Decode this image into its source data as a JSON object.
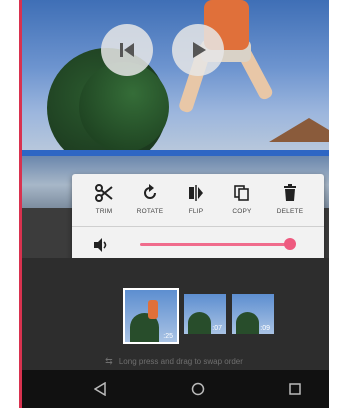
{
  "edit_panel": {
    "tools": [
      {
        "label": "TRIM",
        "icon": "scissors-icon"
      },
      {
        "label": "ROTATE",
        "icon": "rotate-icon"
      },
      {
        "label": "FLIP",
        "icon": "flip-icon"
      },
      {
        "label": "COPY",
        "icon": "copy-icon"
      },
      {
        "label": "DELETE",
        "icon": "trash-icon"
      }
    ],
    "volume": {
      "icon": "volume-icon",
      "level": 0.97
    }
  },
  "player": {
    "controls": [
      {
        "name": "previous",
        "icon": "skip-previous-icon"
      },
      {
        "name": "play",
        "icon": "play-icon"
      }
    ]
  },
  "clips": [
    {
      "duration": ":25",
      "selected": true
    },
    {
      "duration": ":07",
      "selected": false
    },
    {
      "duration": ":09",
      "selected": false
    }
  ],
  "hint": {
    "text": "Long press and drag to swap order",
    "icon": "swap-icon"
  },
  "navbar": {
    "items": [
      "back-icon",
      "home-icon",
      "recent-apps-icon"
    ]
  },
  "colors": {
    "accent": "#ee5a7f",
    "panel": "#f2f2f2",
    "background": "#2d2d2d",
    "edge": "#d8324f"
  }
}
